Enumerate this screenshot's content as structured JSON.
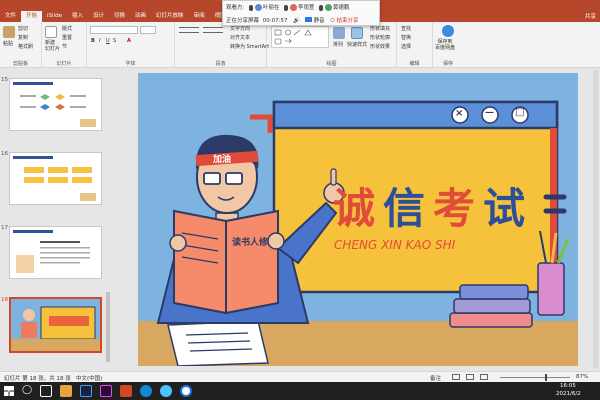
{
  "titlebar": {
    "text": "",
    "color": "#b7472a"
  },
  "tabs": [
    {
      "label": "文件"
    },
    {
      "label": "开始"
    },
    {
      "label": "iSlide"
    },
    {
      "label": "插入"
    },
    {
      "label": "设计"
    },
    {
      "label": "切换"
    },
    {
      "label": "动画"
    },
    {
      "label": "幻灯片放映"
    },
    {
      "label": "审阅"
    },
    {
      "label": "视图"
    },
    {
      "label": "开发"
    }
  ],
  "share_button": "共享",
  "ribbon": {
    "paste": "粘贴",
    "cut": "剪切",
    "copy": "复制",
    "format_painter": "格式刷",
    "new_slide": "新建\n幻灯片",
    "layout": "版式",
    "reset": "重置",
    "section": "节",
    "clipboard_label": "剪贴板",
    "slides_label": "幻灯片",
    "font_label": "字体",
    "paragraph_label": "段落",
    "text_direction": "文字方向",
    "align_text": "对齐文本",
    "smartart": "转换为 SmartArt",
    "drawing_label": "绘图",
    "arrange": "排列",
    "quick_styles": "快速样式",
    "shape_fill": "形状填充",
    "shape_outline": "形状轮廓",
    "shape_effects": "形状效果",
    "find": "查找",
    "replace": "替换",
    "select": "选择",
    "editing_label": "编辑",
    "save_baidu": "保存到\n百度网盘",
    "save_label": "保存"
  },
  "share_bar": {
    "watching": "观看方:",
    "participants": [
      {
        "name": "叶丽在",
        "color": "#5a8ad6"
      },
      {
        "name": "李雨萱",
        "color": "#d66a5a"
      },
      {
        "name": "黄德鹏",
        "color": "#4a9e6a"
      }
    ],
    "sharing_status": "正在分享屏幕",
    "timer": "00:07:57",
    "voice": "静音",
    "end_share": "结束分享"
  },
  "thumbnails": [
    {
      "num": "15"
    },
    {
      "num": "16"
    },
    {
      "num": "17"
    },
    {
      "num": "18",
      "selected": true
    }
  ],
  "slide": {
    "headband": "加油",
    "book_title": "读书人修养",
    "main_title_1": "诚",
    "main_title_2": "信",
    "main_title_3": "考",
    "main_title_4": "试",
    "pinyin": "CHENG XIN KAO SHI",
    "window_close": "×",
    "window_min": "—",
    "window_max": "□"
  },
  "statusbar": {
    "slide_info": "幻灯片 第 18 张，共 18 张",
    "language": "中文(中国)",
    "notes": "备注",
    "zoom": "87%"
  },
  "taskbar": {
    "time": "16:05",
    "date": "2021/6/2"
  }
}
